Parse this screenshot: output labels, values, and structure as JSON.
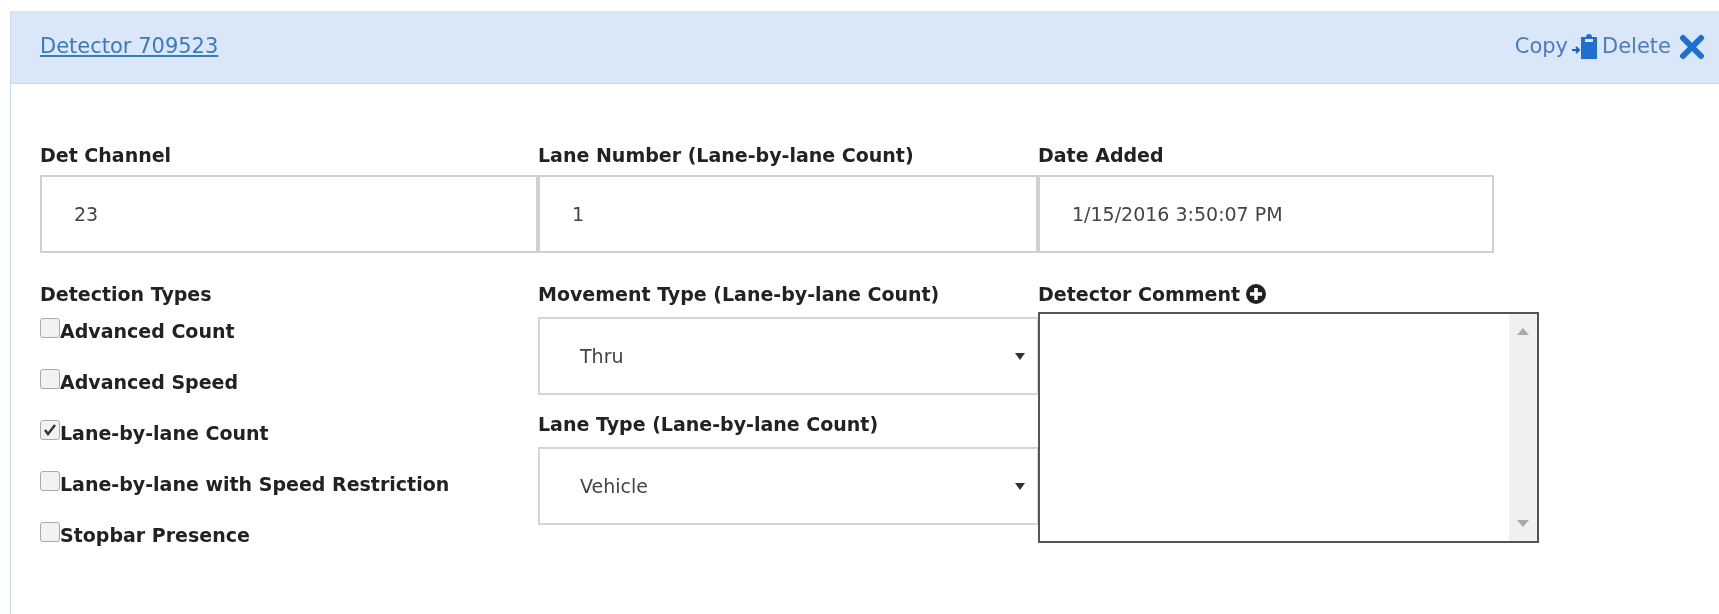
{
  "header": {
    "title": "Detector 709523",
    "actions": [
      {
        "label": "Copy",
        "kind": "copy"
      },
      {
        "label": "Delete",
        "kind": "delete"
      }
    ]
  },
  "fields": [
    {
      "label": "Det Channel",
      "value": "23"
    },
    {
      "label": "Lane Number (Lane-by-lane Count)",
      "value": "1"
    },
    {
      "label": "Date Added",
      "value": "1/15/2016 3:50:07 PM"
    }
  ],
  "detection_types": {
    "label": "Detection Types",
    "options": [
      {
        "label": "Advanced Count",
        "checked": false
      },
      {
        "label": "Advanced Speed",
        "checked": false
      },
      {
        "label": "Lane-by-lane Count",
        "checked": true
      },
      {
        "label": "Lane-by-lane with Speed Restriction",
        "checked": false
      },
      {
        "label": "Stopbar Presence",
        "checked": false
      }
    ]
  },
  "selects": [
    {
      "label": "Movement Type (Lane-by-lane Count)",
      "value": "Thru"
    },
    {
      "label": "Lane Type (Lane-by-lane Count)",
      "value": "Vehicle"
    }
  ],
  "comment": {
    "label": "Detector Comment"
  }
}
